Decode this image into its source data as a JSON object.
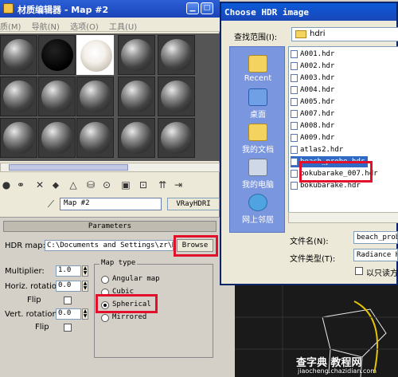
{
  "material_editor": {
    "title": "材质编辑器 - Map #2",
    "menu": [
      "质(M)",
      "导航(N)",
      "选项(O)",
      "工具(U)"
    ],
    "map_name": "Map #2",
    "map_type": "VRayHDRI"
  },
  "parameters": {
    "header": "Parameters",
    "hdr_map_label": "HDR map:",
    "hdr_map_value": "C:\\Documents and Settings\\zr\\M",
    "browse_label": "Browse",
    "multiplier_label": "Multiplier:",
    "multiplier_value": "1.0",
    "horiz_label": "Horiz. rotation:",
    "horiz_value": "0.0",
    "flip1_label": "Flip",
    "vert_label": "Vert. rotation:",
    "vert_value": "0.0",
    "flip2_label": "Flip",
    "map_type_group": "Map type",
    "map_types": [
      "Angular map",
      "Cubic",
      "Spherical",
      "Mirrored"
    ],
    "selected_map_type": "Spherical"
  },
  "dialog": {
    "title": "Choose HDR image",
    "look_in_label": "查找范围(I):",
    "look_in_value": "hdri",
    "places": [
      "Recent",
      "桌面",
      "我的文档",
      "我的电脑",
      "网上邻居"
    ],
    "files": [
      "A001.hdr",
      "A002.hdr",
      "A003.hdr",
      "A004.hdr",
      "A005.hdr",
      "A007.hdr",
      "A008.hdr",
      "A009.hdr",
      "atlas2.hdr",
      "beach_probe.hdr",
      "bokubarake_007.hdr",
      "bokubarake.hdr"
    ],
    "selected_file": "beach_probe.hdr",
    "filename_label": "文件名(N):",
    "filename_value": "beach_probe",
    "filetype_label": "文件类型(T):",
    "filetype_value": "Radiance H",
    "readonly_label": "以只读方"
  },
  "watermark": {
    "line1": "查字典 教程网",
    "line2": "jiaocheng.chazidian.com"
  }
}
